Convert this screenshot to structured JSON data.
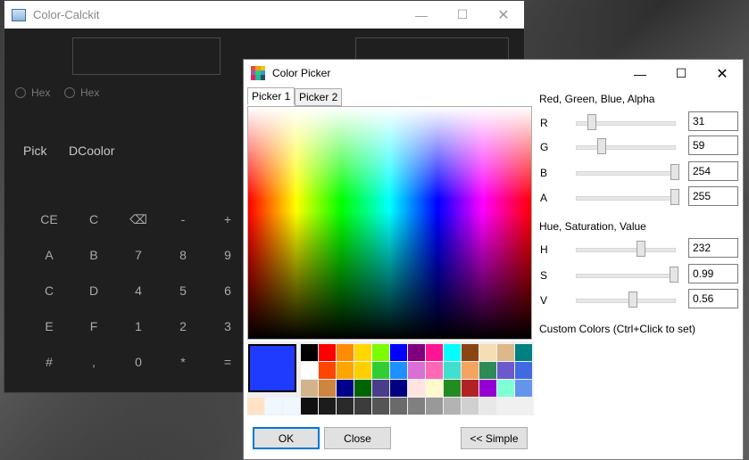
{
  "calculator": {
    "title": "Color-Calckit",
    "radio1": "Hex",
    "radio2": "Hex",
    "pick": "Pick",
    "dcoolor": "DCoolor",
    "keys": [
      [
        "CE",
        "C",
        "⌫",
        "-",
        "+"
      ],
      [
        "A",
        "B",
        "7",
        "8",
        "9"
      ],
      [
        "C",
        "D",
        "4",
        "5",
        "6"
      ],
      [
        "E",
        "F",
        "1",
        "2",
        "3"
      ],
      [
        "#",
        ",",
        "0",
        "*",
        "="
      ]
    ]
  },
  "picker": {
    "title": "Color Picker",
    "tabs": [
      "Picker 1",
      "Picker 2"
    ],
    "rgba_header": "Red, Green, Blue, Alpha",
    "hsv_header": "Hue, Saturation, Value",
    "custom_header": "Custom Colors (Ctrl+Click to set)",
    "sliders": [
      {
        "label": "R",
        "value": "31",
        "level": 0.12
      },
      {
        "label": "G",
        "value": "59",
        "level": 0.23
      },
      {
        "label": "B",
        "value": "254",
        "level": 1.0
      },
      {
        "label": "A",
        "value": "255",
        "level": 1.0
      },
      {
        "label": "H",
        "value": "232",
        "level": 0.64
      },
      {
        "label": "S",
        "value": "0.99",
        "level": 0.99
      },
      {
        "label": "V",
        "value": "0.56",
        "level": 0.56
      }
    ],
    "current_color": "#1F3BFE",
    "swatches": [
      [
        "#000000",
        "#ff0000",
        "#ff8c00",
        "#ffd700",
        "#7cfc00",
        "#0000ff",
        "#800080",
        "#ff1493",
        "#00ffff",
        "#8b4513",
        "#f5deb3",
        "#deb887",
        "#008080"
      ],
      [
        "#ffffff",
        "#ff4500",
        "#ffa500",
        "#ffd000",
        "#32cd32",
        "#1e90ff",
        "#da70d6",
        "#ff69b4",
        "#40e0d0",
        "#f4a460",
        "#2e8b57",
        "#6a5acd",
        "#4169e1"
      ],
      [
        "#d2b48c",
        "#cd853f",
        "#00008b",
        "#006400",
        "#483d8b",
        "#000080",
        "#ffe4e1",
        "#fffacd",
        "#228b22",
        "#b22222",
        "#9400d3",
        "#7fffd4",
        "#6495ed"
      ],
      [
        "#ffe4c4",
        "#f0f8ff",
        "#f0f8ff",
        "#101010",
        "#1c1c1c",
        "#2a2a2a",
        "#3c3c3c",
        "#555555",
        "#6a6a6a",
        "#808080",
        "#999999",
        "#b3b3b3",
        "#d0d0d0",
        "#e8e8e8"
      ]
    ],
    "ok": "OK",
    "close": "Close",
    "simple": "<< Simple"
  }
}
